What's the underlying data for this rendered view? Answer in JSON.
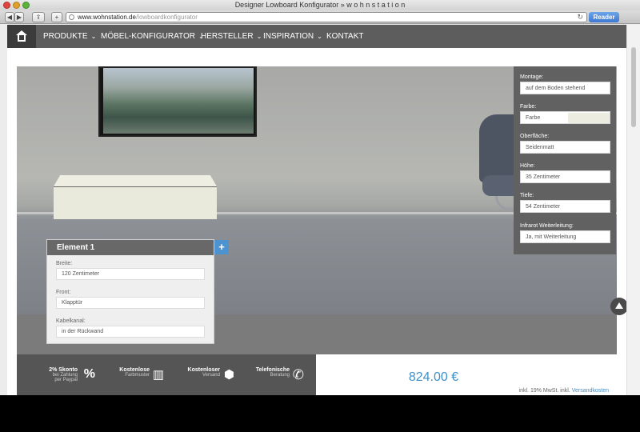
{
  "window": {
    "title": "Designer Lowboard Konfigurator » w o h n s t a t i o n",
    "url_domain": "www.wohnstation.de",
    "url_path": "/lowboardkonfigurator",
    "reader_label": "Reader"
  },
  "nav": {
    "items": [
      {
        "label": "PRODUKTE",
        "has_dropdown": true
      },
      {
        "label": "MÖBEL-KONFIGURATOR",
        "has_dropdown": true
      },
      {
        "label": "HERSTELLER",
        "has_dropdown": true
      },
      {
        "label": "INSPIRATION",
        "has_dropdown": true
      },
      {
        "label": "KONTAKT",
        "has_dropdown": false
      }
    ]
  },
  "options": {
    "montage": {
      "label": "Montage:",
      "value": "auf dem Boden stehend"
    },
    "farbe": {
      "label": "Farbe:",
      "value": "Farbe",
      "swatch_color": "#ecece0"
    },
    "oberflaeche": {
      "label": "Oberfläche:",
      "value": "Seidenmatt"
    },
    "hoehe": {
      "label": "Höhe:",
      "value": "35 Zentimeter"
    },
    "tiefe": {
      "label": "Tiefe:",
      "value": "54 Zentimeter"
    },
    "infrarot": {
      "label": "Infrarot Weiterleitung:",
      "value": "Ja, mit Weiterleitung"
    }
  },
  "element": {
    "title": "Element 1",
    "breite": {
      "label": "Breite:",
      "value": "120 Zentimeter"
    },
    "front": {
      "label": "Front:",
      "value": "Klapptür"
    },
    "kabelkanal": {
      "label": "Kabelkanal:",
      "value": "in der Rückwand"
    },
    "add_label": "+"
  },
  "features": [
    {
      "line1": "2% Skonto",
      "line2a": "bei Zahlung",
      "line2b": "per Paypal",
      "icon": "percent-icon",
      "glyph": "%"
    },
    {
      "line1": "Kostenlose",
      "line2a": "Farbmuster",
      "line2b": "",
      "icon": "swatch-icon",
      "glyph": "▥"
    },
    {
      "line1": "Kostenloser",
      "line2a": "Versand",
      "line2b": "",
      "icon": "package-icon",
      "glyph": "⬢"
    },
    {
      "line1": "Telefonische",
      "line2a": "Beratung",
      "line2b": "",
      "icon": "phone-icon",
      "glyph": "✆"
    }
  ],
  "price": {
    "value": "824.00 €",
    "tax_note": "inkl. 19% MwSt. inkl.",
    "shipping_link": "Versandkosten"
  },
  "colors": {
    "accent": "#3f8fc8",
    "nav_bg": "#5d5d5d",
    "home_bg": "#3b3b3b"
  }
}
